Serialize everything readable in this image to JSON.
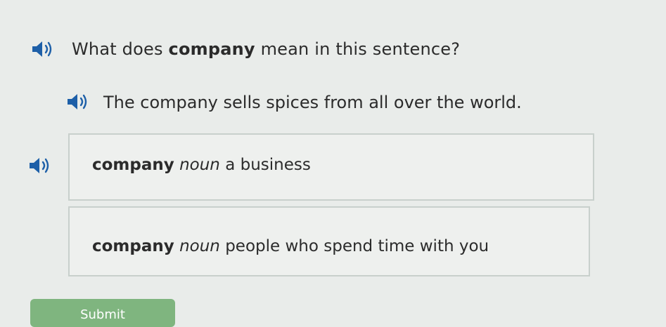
{
  "question": {
    "prefix": "What does ",
    "word": "company",
    "suffix": " mean in this sentence?"
  },
  "sentence": "The company sells spices from all over the world.",
  "options": [
    {
      "word": "company",
      "pos": "noun",
      "definition": "a business"
    },
    {
      "word": "company",
      "pos": "noun",
      "definition": "people who spend time with you"
    }
  ],
  "submit_label": "Submit",
  "icons": {
    "speaker": "speaker-audio-icon"
  },
  "colors": {
    "icon": "#1d5fa8",
    "submit": "#7fb57f"
  }
}
